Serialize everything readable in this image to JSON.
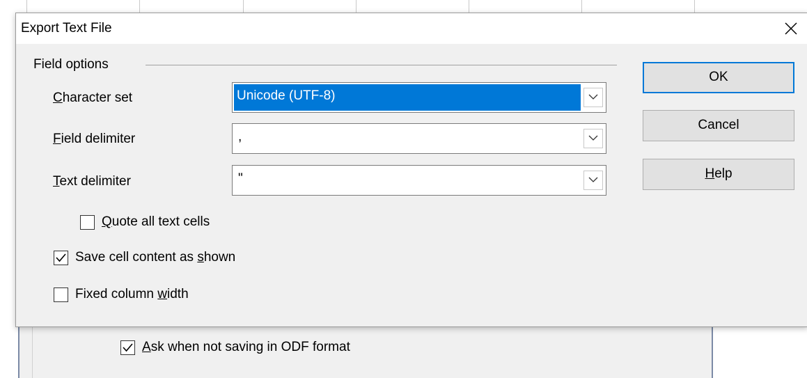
{
  "dialog": {
    "title": "Export Text File",
    "close_icon": "close-icon"
  },
  "field_options": {
    "group_label": "Field options",
    "character_set": {
      "label_underlined": "C",
      "label_rest": "haracter set",
      "value": "Unicode (UTF-8)",
      "selected": true
    },
    "field_delimiter": {
      "label_underlined": "F",
      "label_rest": "ield delimiter",
      "value": ","
    },
    "text_delimiter": {
      "label_underlined": "T",
      "label_rest": "ext delimiter",
      "value": "\""
    }
  },
  "checkboxes": {
    "quote_all": {
      "label_underlined": "Q",
      "label_rest": "uote all text cells",
      "checked": false
    },
    "save_as_shown": {
      "label_pre": "Save cell content as ",
      "label_underlined": "s",
      "label_rest": "hown",
      "checked": true
    },
    "fixed_width": {
      "label_pre": "Fixed column ",
      "label_underlined": "w",
      "label_rest": "idth",
      "checked": false
    }
  },
  "buttons": {
    "ok": "OK",
    "cancel": "Cancel",
    "help_underlined": "H",
    "help_rest": "elp"
  },
  "background_panel": {
    "ask_odf": {
      "label_underlined": "A",
      "label_rest": "sk when not saving in ODF format",
      "checked": true
    }
  },
  "colors": {
    "accent": "#0078d7",
    "dialog_bg": "#f0f0f0",
    "button_bg": "#e1e1e1"
  }
}
